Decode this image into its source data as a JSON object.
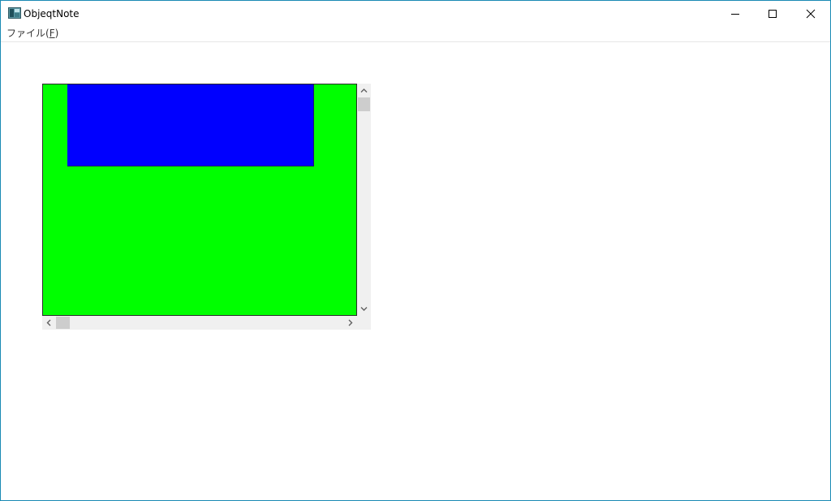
{
  "window": {
    "title": "ObjeqtNote",
    "icon": "app-icon",
    "accent_color": "#1a8ab4"
  },
  "menubar": {
    "items": [
      {
        "label": "ファイル(",
        "mnemonic": "F",
        "suffix": ")"
      }
    ]
  },
  "canvas": {
    "background_color": "#00ff00",
    "shape_color": "#0000ff"
  },
  "icons": {
    "minimize": "minimize-icon",
    "maximize": "maximize-icon",
    "close": "close-icon",
    "scroll_up": "chevron-up-icon",
    "scroll_down": "chevron-down-icon",
    "scroll_left": "chevron-left-icon",
    "scroll_right": "chevron-right-icon"
  }
}
